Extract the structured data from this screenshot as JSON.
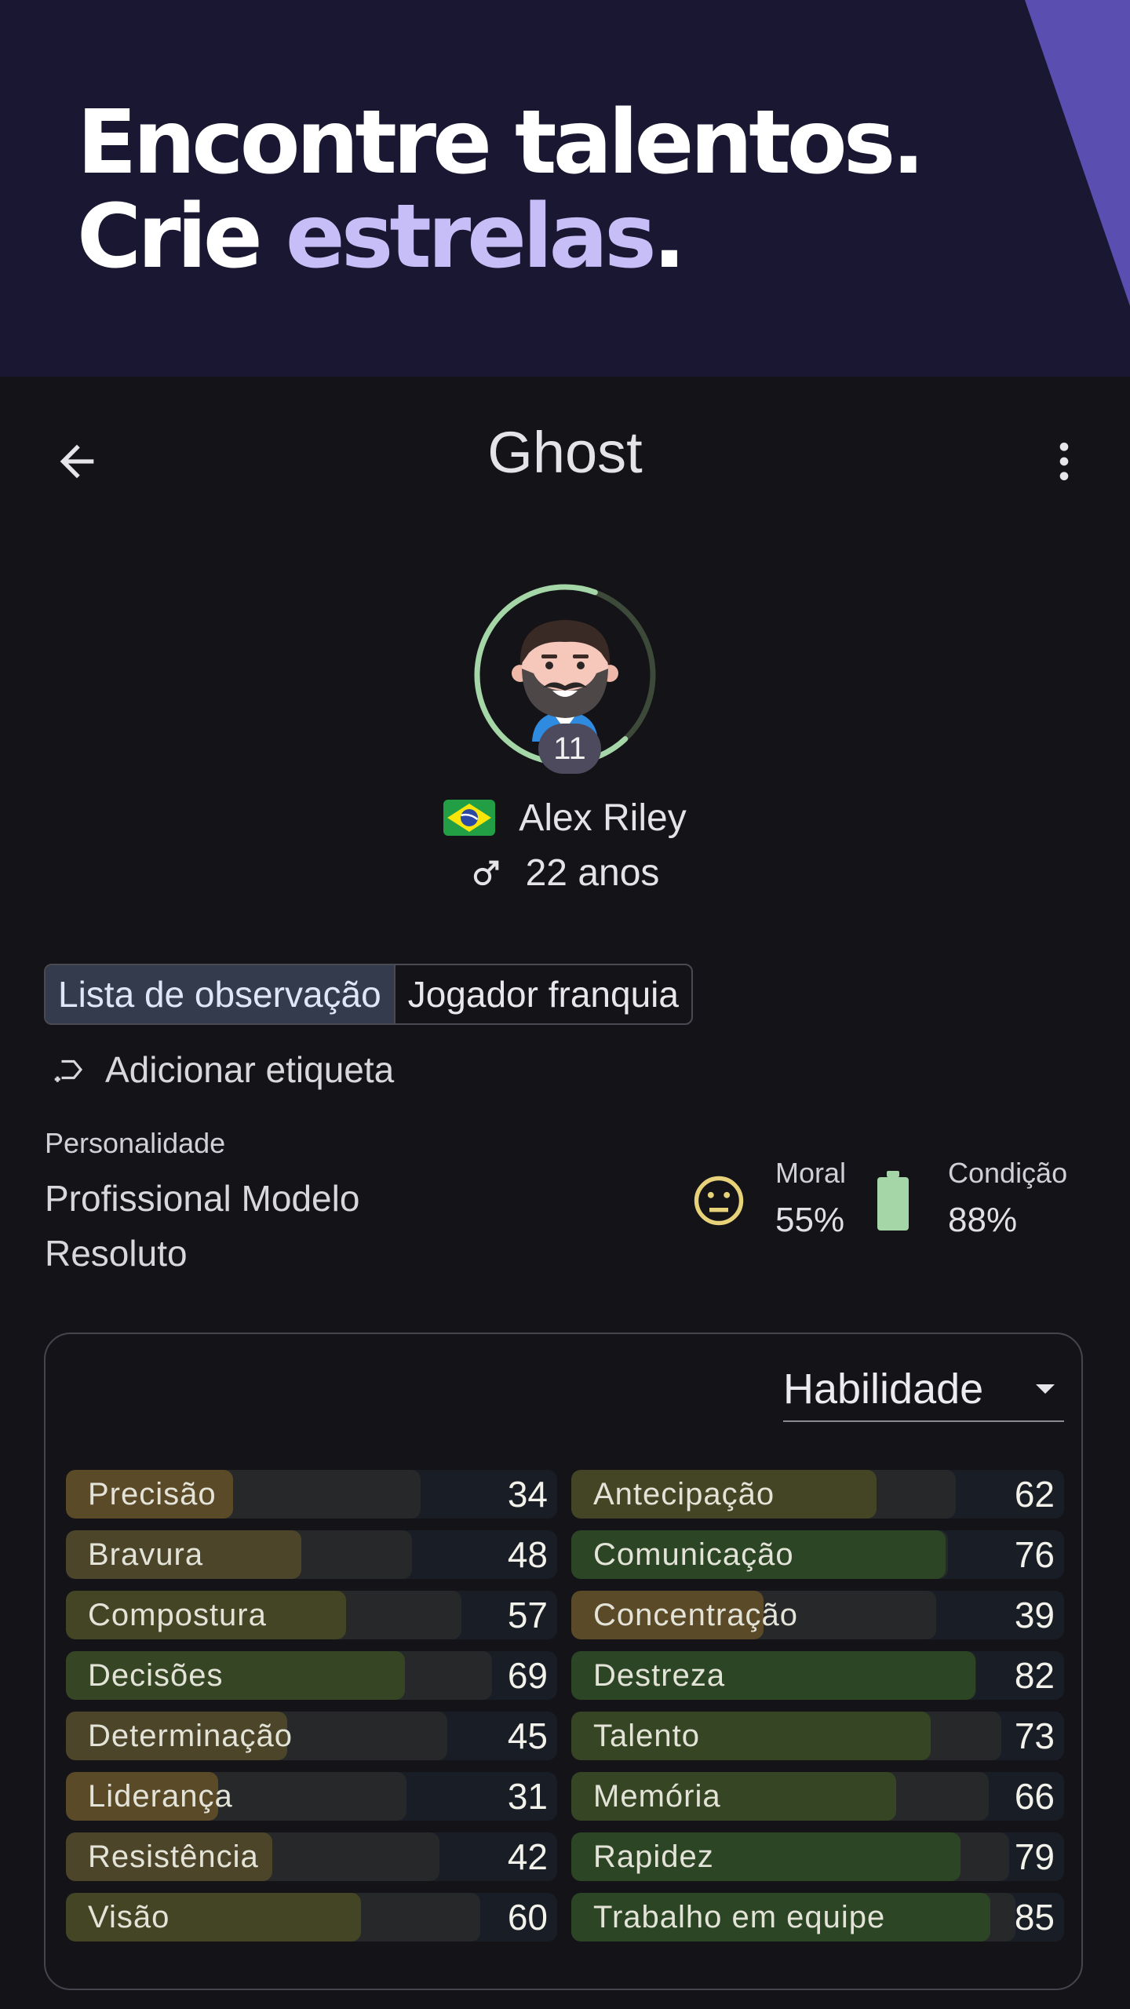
{
  "banner": {
    "line1": "Encontre talentos.",
    "line2_prefix": "Crie ",
    "line2_accent": "estrelas",
    "line2_suffix": "."
  },
  "appbar": {
    "back_icon": "arrow-left-icon",
    "title": "Ghost",
    "menu_icon": "more-vertical-icon"
  },
  "player": {
    "avatar_icon": "bearded-man-avatar",
    "number": "11",
    "flag_icon": "brazil-flag-icon",
    "name": "Alex Riley",
    "gender_icon": "male-symbol-icon",
    "age": "22 anos",
    "avatar_ring_color": "#a5d6a7"
  },
  "tags": [
    {
      "label": "Lista de observação",
      "selected": true
    },
    {
      "label": "Jogador franquia",
      "selected": false
    }
  ],
  "add_tag": {
    "icon": "add-label-icon",
    "label": "Adicionar etiqueta"
  },
  "personality": {
    "label": "Personalidade",
    "value": "Profissional Modelo Resoluto"
  },
  "status": {
    "moral": {
      "icon": "neutral-face-icon",
      "label": "Moral",
      "value": "55%",
      "color": "#e7d27a"
    },
    "condition": {
      "icon": "battery-icon",
      "label": "Condição",
      "value": "88%",
      "color": "#a5d6a7"
    }
  },
  "attributes": {
    "dropdown_label": "Habilidade",
    "dropdown_icon": "dropdown-arrow-icon",
    "left": [
      {
        "name": "Precisão",
        "value": "34"
      },
      {
        "name": "Bravura",
        "value": "48"
      },
      {
        "name": "Compostura",
        "value": "57"
      },
      {
        "name": "Decisões",
        "value": "69"
      },
      {
        "name": "Determinação",
        "value": "45"
      },
      {
        "name": "Liderança",
        "value": "31"
      },
      {
        "name": "Resistência",
        "value": "42"
      },
      {
        "name": "Visão",
        "value": "60"
      }
    ],
    "right": [
      {
        "name": "Antecipação",
        "value": "62"
      },
      {
        "name": "Comunicação",
        "value": "76"
      },
      {
        "name": "Concentração",
        "value": "39"
      },
      {
        "name": "Destreza",
        "value": "82"
      },
      {
        "name": "Talento",
        "value": "73"
      },
      {
        "name": "Memória",
        "value": "66"
      },
      {
        "name": "Rapidez",
        "value": "79"
      },
      {
        "name": "Trabalho em equipe",
        "value": "85"
      }
    ]
  }
}
